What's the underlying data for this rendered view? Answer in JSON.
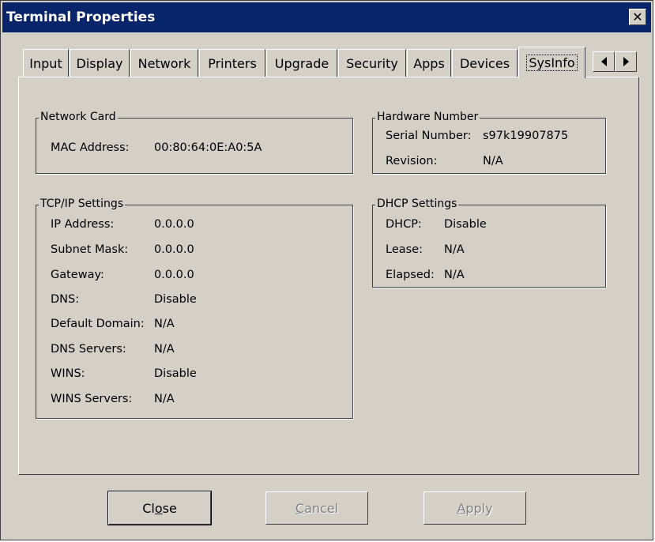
{
  "window": {
    "title": "Terminal Properties",
    "close_glyph": "✕"
  },
  "tabs": [
    {
      "label": "Input"
    },
    {
      "label": "Display"
    },
    {
      "label": "Network"
    },
    {
      "label": "Printers"
    },
    {
      "label": "Upgrade"
    },
    {
      "label": "Security"
    },
    {
      "label": "Apps"
    },
    {
      "label": "Devices"
    },
    {
      "label": "SysInfo",
      "active": true
    }
  ],
  "network_card": {
    "legend": "Network Card",
    "mac_label": "MAC Address:",
    "mac_value": "00:80:64:0E:A0:5A"
  },
  "hardware": {
    "legend": "Hardware Number",
    "serial_label": "Serial Number:",
    "serial_value": "s97k19907875",
    "revision_label": "Revision:",
    "revision_value": "N/A"
  },
  "tcpip": {
    "legend": "TCP/IP Settings",
    "rows": [
      {
        "label": "IP Address:",
        "value": "0.0.0.0"
      },
      {
        "label": "Subnet Mask:",
        "value": "0.0.0.0"
      },
      {
        "label": "Gateway:",
        "value": "0.0.0.0"
      },
      {
        "label": "DNS:",
        "value": "Disable"
      },
      {
        "label": "Default Domain:",
        "value": "N/A"
      },
      {
        "label": "DNS Servers:",
        "value": "N/A"
      },
      {
        "label": "WINS:",
        "value": "Disable"
      },
      {
        "label": "WINS Servers:",
        "value": "N/A"
      }
    ]
  },
  "dhcp": {
    "legend": "DHCP Settings",
    "rows": [
      {
        "label": "DHCP:",
        "value": "Disable"
      },
      {
        "label": "Lease:",
        "value": "N/A"
      },
      {
        "label": "Elapsed:",
        "value": "N/A"
      }
    ]
  },
  "buttons": {
    "close": {
      "pre": "Cl",
      "mnemonic": "o",
      "post": "se"
    },
    "cancel": {
      "mnemonic": "C",
      "post": "ancel"
    },
    "apply": {
      "mnemonic": "A",
      "post": "pply"
    }
  },
  "colors": {
    "titlebar": "#08246b",
    "face": "#d4d0c8",
    "disabled_text": "#808080"
  }
}
